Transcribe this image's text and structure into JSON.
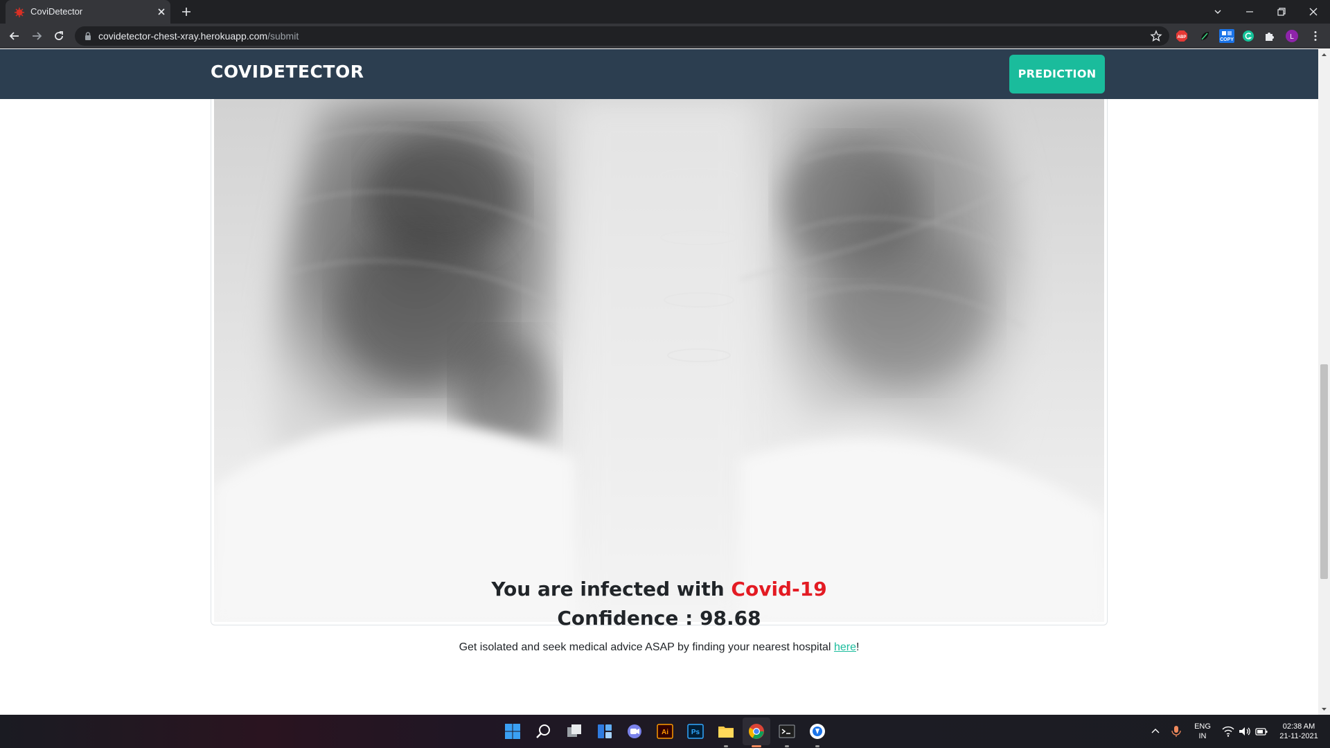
{
  "browser": {
    "tab_title": "CoviDetector",
    "url_host": "covidetector-chest-xray.herokuapp.com",
    "url_path": "/submit",
    "extensions": [
      "adblock-plus",
      "leaf-extension",
      "copy-extension",
      "grammarly",
      "extensions-puzzle",
      "profile-avatar"
    ],
    "ext_labels": {
      "abp": "ABP",
      "copy": "COPY",
      "avatar": "L"
    }
  },
  "site": {
    "brand": "COVIDETECTOR",
    "nav_button": "PREDICTION"
  },
  "result": {
    "prefix": "You are infected with",
    "diagnosis": "Covid-19",
    "confidence_label": "Confidence :",
    "confidence_value": "98.68",
    "advice_text": "Get isolated and seek medical advice ASAP by finding your nearest hospital",
    "advice_link": "here",
    "advice_suffix": "!"
  },
  "taskbar": {
    "apps": [
      "start",
      "search",
      "task-view",
      "widgets",
      "teams-chat",
      "illustrator",
      "photoshop",
      "file-explorer",
      "chrome",
      "terminal",
      "app"
    ],
    "ai_label": "Ai",
    "ps_label": "Ps",
    "lang_line1": "ENG",
    "lang_line2": "IN",
    "time": "02:38 AM",
    "date": "21-11-2021"
  },
  "colors": {
    "nav_bg": "#2c3e50",
    "accent": "#1abc9c",
    "diagnosis": "#e31b23"
  }
}
